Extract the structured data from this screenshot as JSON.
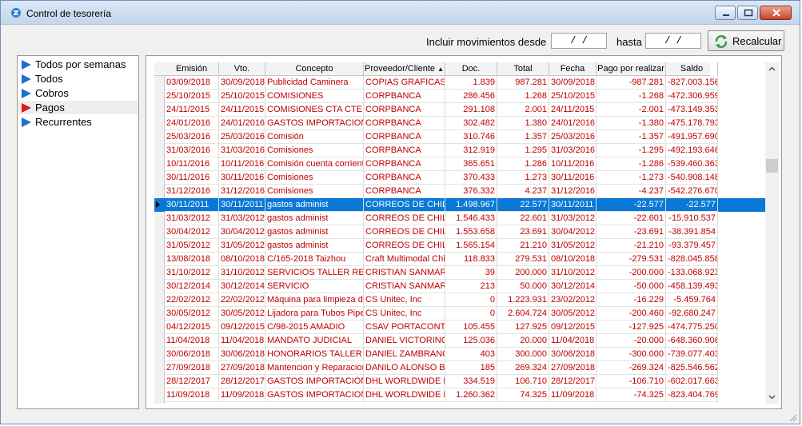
{
  "window": {
    "title": "Control de tesorería"
  },
  "filter": {
    "include_label": "Incluir movimientos desde",
    "from_value": "/ /",
    "to_label": "hasta",
    "to_value": "/ /",
    "recalc_label": "Recalcular"
  },
  "sidebar": {
    "items": [
      {
        "label": "Todos por semanas",
        "color": "#1e6fd0"
      },
      {
        "label": "Todos",
        "color": "#1e6fd0"
      },
      {
        "label": "Cobros",
        "color": "#1e6fd0"
      },
      {
        "label": "Pagos",
        "color": "#d81b1b"
      },
      {
        "label": "Recurrentes",
        "color": "#1e6fd0"
      }
    ],
    "selected_index": 3
  },
  "grid": {
    "columns": [
      "Emisión",
      "Vto.",
      "Concepto",
      "Proveedor/Cliente",
      "Doc.",
      "Total",
      "Fecha",
      "Pago por realizar",
      "Saldo"
    ],
    "sort_indicator": "▲",
    "selected_row_index": 9,
    "rows": [
      [
        "03/09/2018",
        "30/09/2018",
        "Publicidad Caminera",
        "COPIAS GRAFICAS",
        "1.839",
        "987.281",
        "30/09/2018",
        "-987.281",
        "-827.003.156"
      ],
      [
        "25/10/2015",
        "25/10/2015",
        "COMISIONES",
        "CORPBANCA",
        "286.456",
        "1.268",
        "25/10/2015",
        "-1.268",
        "-472.306.959"
      ],
      [
        "24/11/2015",
        "24/11/2015",
        "COMISIONES CTA CTE",
        "CORPBANCA",
        "291.108",
        "2.001",
        "24/11/2015",
        "-2.001",
        "-473.149.353"
      ],
      [
        "24/01/2016",
        "24/01/2016",
        "GASTOS IMPORTACION",
        "CORPBANCA",
        "302.482",
        "1.380",
        "24/01/2016",
        "-1.380",
        "-475.178.793"
      ],
      [
        "25/03/2016",
        "25/03/2016",
        "Comisión",
        "CORPBANCA",
        "310.746",
        "1.357",
        "25/03/2016",
        "-1.357",
        "-491.957.690"
      ],
      [
        "31/03/2016",
        "31/03/2016",
        "Comisiones",
        "CORPBANCA",
        "312.919",
        "1.295",
        "31/03/2016",
        "-1.295",
        "-492.193.646"
      ],
      [
        "10/11/2016",
        "10/11/2016",
        "Comisión cuenta corrient",
        "CORPBANCA",
        "365.651",
        "1.286",
        "10/11/2016",
        "-1.286",
        "-539.460.363"
      ],
      [
        "30/11/2016",
        "30/11/2016",
        "Comisiones",
        "CORPBANCA",
        "370.433",
        "1.273",
        "30/11/2016",
        "-1.273",
        "-540.908.148"
      ],
      [
        "31/12/2016",
        "31/12/2016",
        "Comisiones",
        "CORPBANCA",
        "376.332",
        "4.237",
        "31/12/2016",
        "-4.237",
        "-542.276.670"
      ],
      [
        "30/11/2011",
        "30/11/2011",
        "gastos administ",
        "CORREOS DE CHILE",
        "1.498.967",
        "22.577",
        "30/11/2011",
        "-22.577",
        "-22.577"
      ],
      [
        "31/03/2012",
        "31/03/2012",
        "gastos administ",
        "CORREOS DE CHILE",
        "1.546.433",
        "22.601",
        "31/03/2012",
        "-22.601",
        "-15.910.537"
      ],
      [
        "30/04/2012",
        "30/04/2012",
        "gastos administ",
        "CORREOS DE CHILE",
        "1.553.658",
        "23.691",
        "30/04/2012",
        "-23.691",
        "-38.391.854"
      ],
      [
        "31/05/2012",
        "31/05/2012",
        "gastos administ",
        "CORREOS DE CHILE",
        "1.565.154",
        "21.210",
        "31/05/2012",
        "-21.210",
        "-93.379.457"
      ],
      [
        "13/08/2018",
        "08/10/2018",
        "C/165-2018 Taizhou",
        "Craft Multimodal Chile",
        "118.833",
        "279.531",
        "08/10/2018",
        "-279.531",
        "-828.045.858"
      ],
      [
        "31/10/2012",
        "31/10/2012",
        "SERVICIOS TALLER REE",
        "CRISTIAN SANMART",
        "39",
        "200.000",
        "31/10/2012",
        "-200.000",
        "-133.068.923"
      ],
      [
        "30/12/2014",
        "30/12/2014",
        "SERVICIO",
        "CRISTIAN SANMART",
        "213",
        "50.000",
        "30/12/2014",
        "-50.000",
        "-458.139.493"
      ],
      [
        "22/02/2012",
        "22/02/2012",
        "Máquina para limpieza de",
        "CS Unitec, Inc",
        "0",
        "1.223.931",
        "23/02/2012",
        "-16.229",
        "-5.459.764"
      ],
      [
        "30/05/2012",
        "30/05/2012",
        "Lijadora para Tubos Pipe",
        "CS Unitec, Inc",
        "0",
        "2.604.724",
        "30/05/2012",
        "-200.460",
        "-92.680.247"
      ],
      [
        "04/12/2015",
        "09/12/2015",
        "C/98-2015 AMADIO",
        "CSAV PORTACONT",
        "105.455",
        "127.925",
        "09/12/2015",
        "-127.925",
        "-474.775.250"
      ],
      [
        "11/04/2018",
        "11/04/2018",
        "MANDATO JUDICIAL",
        "DANIEL VICTORINO",
        "125.036",
        "20.000",
        "11/04/2018",
        "-20.000",
        "-648.360.906"
      ],
      [
        "30/06/2018",
        "30/06/2018",
        "HONORARIOS TALLER",
        "DANIEL ZAMBRANO",
        "403",
        "300.000",
        "30/06/2018",
        "-300.000",
        "-739.077.403"
      ],
      [
        "27/09/2018",
        "27/09/2018",
        "Mantencion y Reparacion",
        "DANILO ALONSO BR",
        "185",
        "269.324",
        "27/09/2018",
        "-269.324",
        "-825.546.562"
      ],
      [
        "28/12/2017",
        "28/12/2017",
        "GASTOS IMPORTACION",
        "DHL WORLDWIDE EX",
        "334.519",
        "106.710",
        "28/12/2017",
        "-106.710",
        "-602.017.663"
      ],
      [
        "11/09/2018",
        "11/09/2018",
        "GASTOS IMPORTACION",
        "DHL WORLDWIDE EX",
        "1.260.362",
        "74.325",
        "11/09/2018",
        "-74.325",
        "-823.404.769"
      ]
    ]
  }
}
